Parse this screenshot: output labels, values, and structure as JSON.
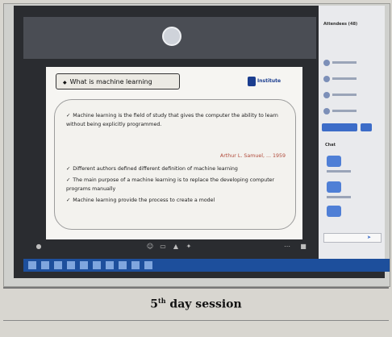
{
  "slide": {
    "title": "What is machine learning",
    "logo_text": "Institute",
    "bullets": [
      "Machine learning is the field of study that gives the computer the ability to learn without being explicitly programmed.",
      "Different authors defined different definition of machine learning",
      "The main purpose of a machine learning is to replace the developing computer programs manually",
      "Machine learning provide the process to create a model"
    ],
    "citation": "Arthur L. Samuel, ... 1959"
  },
  "side_panel": {
    "header": "Attendees (48)",
    "chat_title": "Chat"
  },
  "caption": {
    "number": "5",
    "suffix": "th",
    "rest": " day session"
  }
}
